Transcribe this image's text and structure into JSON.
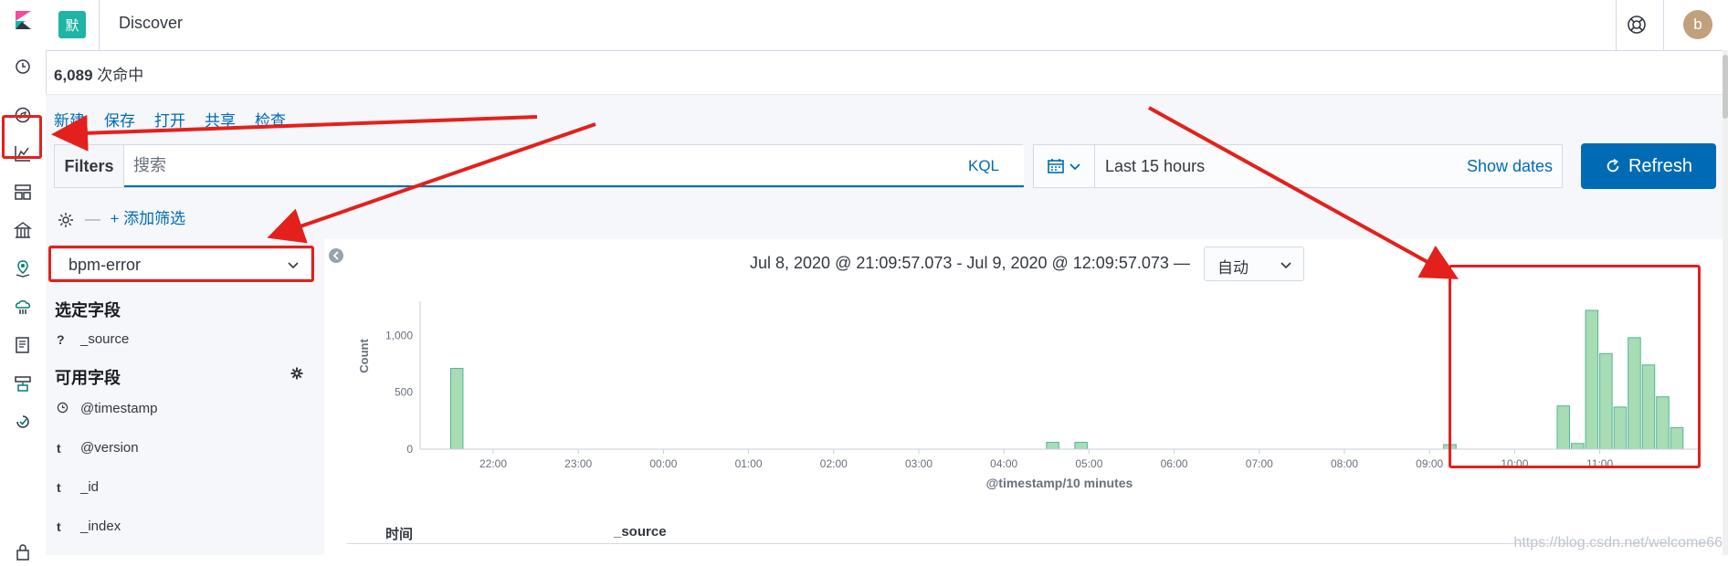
{
  "header": {
    "space_badge": "默",
    "app_title": "Discover",
    "avatar_letter": "b"
  },
  "nav": {
    "icons": [
      "kibana-logo-icon",
      "clock-icon",
      "compass-icon",
      "visualize-icon",
      "dashboard-icon",
      "canvas-icon",
      "maps-icon",
      "ml-icon",
      "logs-icon",
      "infra-icon",
      "uptime-icon",
      "lock-icon"
    ]
  },
  "hits": {
    "count": "6,089",
    "label": "次命中"
  },
  "top_links": [
    "新建",
    "保存",
    "打开",
    "共享",
    "检查"
  ],
  "filter_bar": {
    "label": "Filters",
    "placeholder": "搜索",
    "kql": "KQL",
    "add_filter": "+ 添加筛选"
  },
  "date_picker": {
    "range": "Last 15 hours",
    "show_dates": "Show dates"
  },
  "refresh": {
    "label": "Refresh"
  },
  "sidebar": {
    "index_pattern": "bpm-error",
    "selected_title": "选定字段",
    "selected_fields": [
      {
        "type": "?",
        "name": "_source"
      }
    ],
    "available_title": "可用字段",
    "available_fields": [
      {
        "type": "clock",
        "name": "@timestamp"
      },
      {
        "type": "t",
        "name": "@version"
      },
      {
        "type": "t",
        "name": "_id"
      },
      {
        "type": "t",
        "name": "_index"
      }
    ]
  },
  "histogram_header": {
    "range_text": "Jul 8, 2020 @ 21:09:57.073 - Jul 9, 2020 @ 12:09:57.073 —",
    "interval": "自动"
  },
  "chart_data": {
    "type": "bar",
    "xlabel": "@timestamp/10 minutes",
    "ylabel": "Count",
    "x_ticks": [
      "22:00",
      "23:00",
      "00:00",
      "01:00",
      "02:00",
      "03:00",
      "04:00",
      "05:00",
      "06:00",
      "07:00",
      "08:00",
      "09:00",
      "10:00",
      "11:00"
    ],
    "y_ticks": [
      "0",
      "500",
      "1,000"
    ],
    "ylim": [
      0,
      1300
    ],
    "bars": [
      {
        "x": "21:30",
        "value": 710
      },
      {
        "x": "04:30",
        "value": 60
      },
      {
        "x": "04:50",
        "value": 60
      },
      {
        "x": "09:10",
        "value": 40
      },
      {
        "x": "10:30",
        "value": 380
      },
      {
        "x": "10:40",
        "value": 50
      },
      {
        "x": "10:50",
        "value": 1220
      },
      {
        "x": "11:00",
        "value": 840
      },
      {
        "x": "11:10",
        "value": 370
      },
      {
        "x": "11:20",
        "value": 980
      },
      {
        "x": "11:30",
        "value": 740
      },
      {
        "x": "11:40",
        "value": 460
      },
      {
        "x": "11:50",
        "value": 190
      }
    ],
    "bar_color": "#a8dcb4",
    "bar_stroke": "#54b399"
  },
  "table": {
    "col_time": "时间",
    "col_source": "_source"
  },
  "watermark": "https://blog.csdn.net/welcome66"
}
